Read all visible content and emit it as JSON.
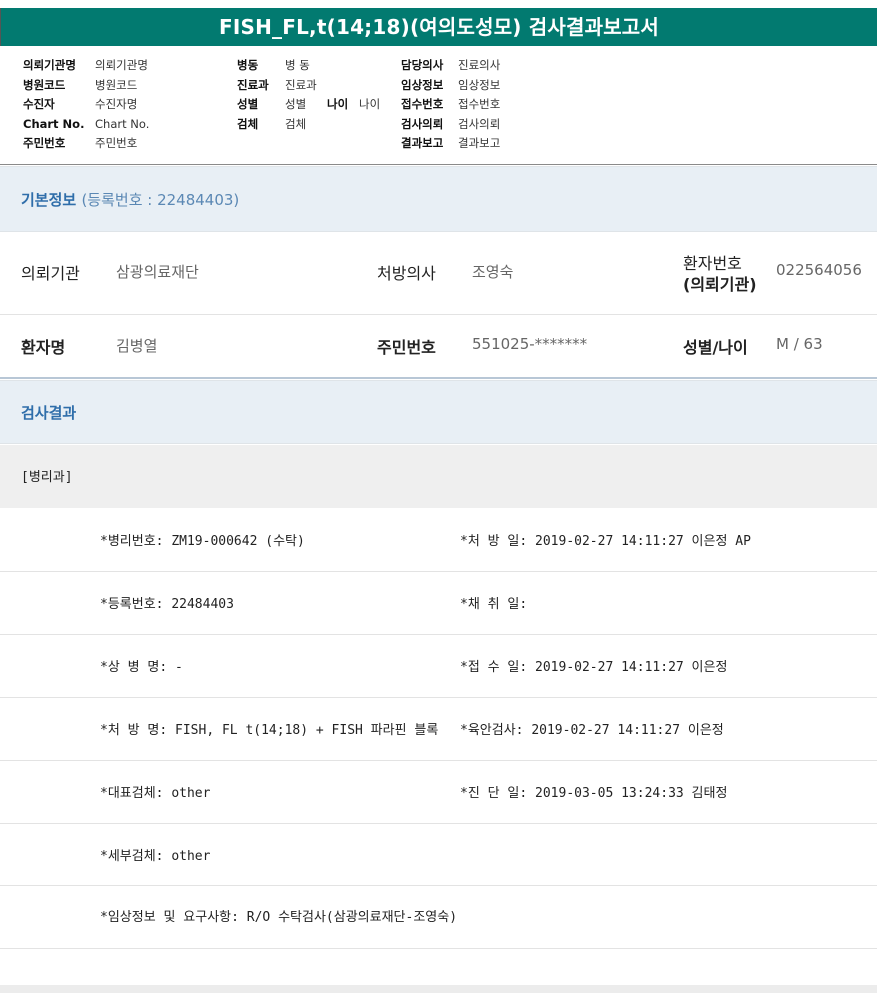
{
  "title": "FISH_FL,t(14;18)(여의도성모) 검사결과보고서",
  "header": {
    "col1": [
      {
        "label": "의뢰기관명",
        "value": "의뢰기관명"
      },
      {
        "label": "병원코드",
        "value": "병원코드"
      },
      {
        "label": "수진자",
        "value": "수진자명"
      },
      {
        "label": "Chart No.",
        "value": "Chart No."
      },
      {
        "label": "주민번호",
        "value": "주민번호"
      }
    ],
    "col2": [
      {
        "label": "병동",
        "value": "병 동"
      },
      {
        "label": "진료과",
        "value": "진료과"
      },
      {
        "label": "성별",
        "value": "성별",
        "label2": "나이",
        "value2": "나이"
      },
      {
        "label": "검체",
        "value": "검체"
      }
    ],
    "col3": [
      {
        "label": "담당의사",
        "value": "진료의사"
      },
      {
        "label": "임상정보",
        "value": "임상정보"
      },
      {
        "label": "접수번호",
        "value": "접수번호"
      },
      {
        "label": "검사의뢰",
        "value": "검사의뢰"
      },
      {
        "label": "결과보고",
        "value": "결과보고"
      }
    ]
  },
  "basic": {
    "heading": "기본정보",
    "reg_text": "(등록번호 : 22484403)",
    "row1": {
      "l1": "의뢰기관",
      "v1": "삼광의료재단",
      "l2": "처방의사",
      "v2": "조영숙",
      "l3a": "환자번호",
      "l3b": "(의뢰기관)",
      "v3": "022564056"
    },
    "row2": {
      "l1": "환자명",
      "v1": "김병열",
      "l2": "주민번호",
      "v2": "551025-*******",
      "l3": "성별/나이",
      "v3": "M / 63"
    }
  },
  "results": {
    "heading": "검사결과",
    "section": "[병리과]",
    "rows": [
      {
        "left": "*병리번호: ZM19-000642 (수탁)",
        "right": "*처 방 일: 2019-02-27 14:11:27  이은정 AP"
      },
      {
        "left": "*등록번호: 22484403",
        "right": "*채 취 일:"
      },
      {
        "left": "*상 병 명: -",
        "right": "*접 수 일: 2019-02-27 14:11:27  이은정"
      },
      {
        "left": "*처 방 명: FISH, FL t(14;18) + FISH 파라핀 블록",
        "right": "*육안검사: 2019-02-27 14:11:27  이은정"
      },
      {
        "left": "*대표검체: other",
        "right": "*진 단 일: 2019-03-05 13:24:33  김태정"
      },
      {
        "left": "*세부검체: other",
        "right": ""
      },
      {
        "left": "*임상정보 및 요구사항: R/O 수탁검사(삼광의료재단-조영숙)",
        "right": ""
      }
    ]
  },
  "colors": {
    "title_bar": "#027a70",
    "band_bg": "#e8eff5",
    "heading_blue": "#2f6eaa"
  }
}
